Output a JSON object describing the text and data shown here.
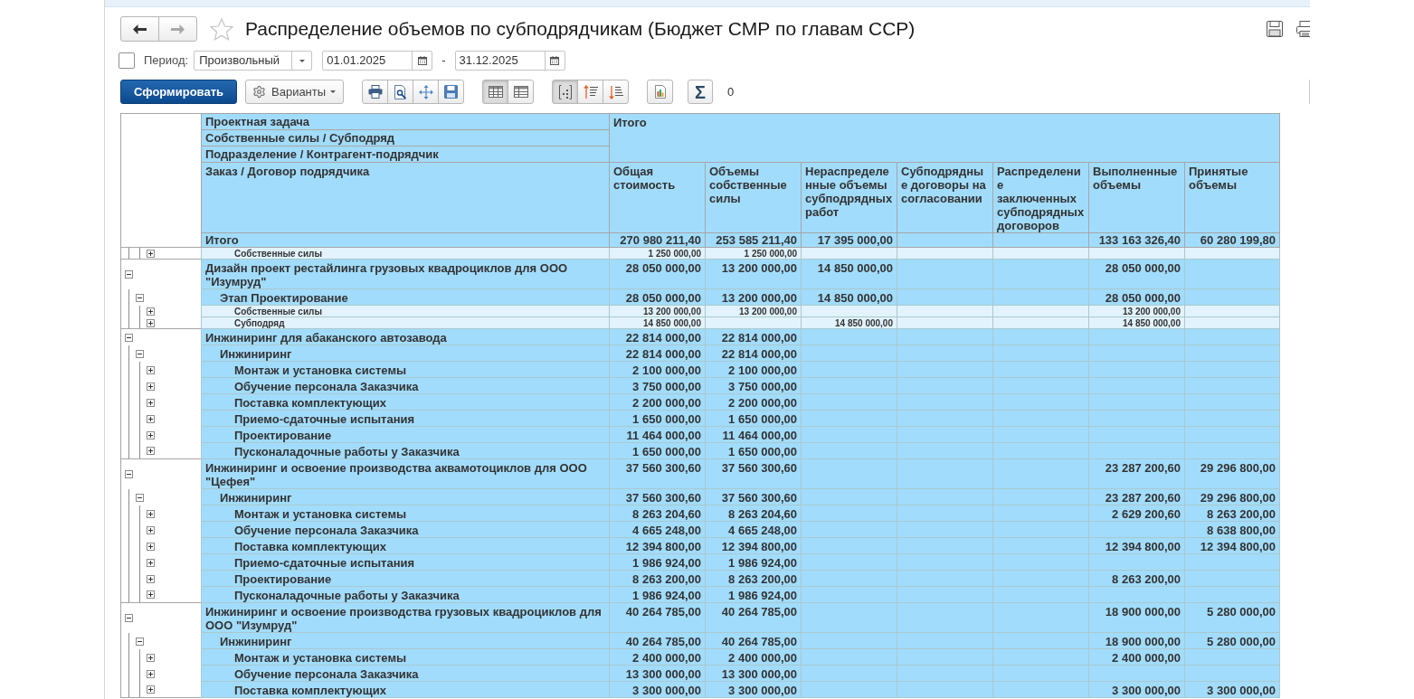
{
  "window": {
    "title": "Распределение объемов по субподрядчикам (Бюджет СМР по главам ССР)",
    "favorite": false
  },
  "nav": [
    {
      "kind": "back",
      "disabled": false
    },
    {
      "kind": "forward",
      "disabled": true
    }
  ],
  "period": {
    "checked": false,
    "label": "Период:",
    "mode": "Произвольный",
    "date_from": "01.01.2025",
    "separator": "-",
    "date_to": "31.12.2025"
  },
  "toolbar": {
    "generate": "Сформировать",
    "variants": "Варианты",
    "groups": [
      {
        "buttons": [
          {
            "kind": "print"
          },
          {
            "kind": "preview"
          },
          {
            "kind": "move"
          },
          {
            "kind": "save"
          }
        ]
      },
      {
        "buttons": [
          {
            "kind": "table",
            "selected": true
          },
          {
            "kind": "grid",
            "selected": false
          }
        ]
      },
      {
        "buttons": [
          {
            "kind": "group",
            "selected": true
          },
          {
            "kind": "sort_asc",
            "selected": false
          },
          {
            "kind": "sort_desc",
            "selected": false
          }
        ]
      },
      {
        "buttons": [
          {
            "kind": "chart"
          }
        ]
      }
    ],
    "sum": "Σ",
    "sum_value": "0"
  },
  "table": {
    "row_group_headers": [
      "Проектная задача",
      "Собственные силы / Субподряд",
      "Подразделение / Контрагент-подрядчик"
    ],
    "row_header": "Заказ / Договор подрядчика",
    "column_group": "Итого",
    "columns": [
      "Общая стоимость",
      "Объемы собственные силы",
      "Нераспределенные объемы субподрядных работ",
      "Субподрядные договоры на согласовании",
      "Распределение заключенных субподрядных договоров",
      "Выполненные объемы",
      "Принятые объемы"
    ],
    "total": {
      "label": "Итого",
      "values": {
        "total_cost": "270 980 211,40",
        "own_forces": "253 585 211,40",
        "unallocated": "17 395 000,00",
        "completed": "133 163 326,40",
        "accepted": "60 280 199,80"
      }
    },
    "rows": [
      {
        "children": [
          {
            "children": [
              {
                "kind": "detail",
                "label": "Собственные силы",
                "expanded": false,
                "values": {
                  "total_cost": "1 250 000,00",
                  "own_forces": "1 250 000,00"
                }
              }
            ]
          }
        ]
      },
      {
        "kind": "group",
        "label": "Дизайн проект рестайлинга грузовых квадроциклов для ООО \"Изумруд\"",
        "expanded": true,
        "values": {
          "total_cost": "28 050 000,00",
          "own_forces": "13 200 000,00",
          "unallocated": "14 850 000,00",
          "completed": "28 050 000,00"
        },
        "children": [
          {
            "kind": "group",
            "label": "Этап Проектирование",
            "expanded": true,
            "values": {
              "total_cost": "28 050 000,00",
              "own_forces": "13 200 000,00",
              "unallocated": "14 850 000,00",
              "completed": "28 050 000,00"
            },
            "children": [
              {
                "kind": "detail",
                "label": "Собственные силы",
                "expanded": false,
                "values": {
                  "total_cost": "13 200 000,00",
                  "own_forces": "13 200 000,00",
                  "completed": "13 200 000,00"
                }
              },
              {
                "kind": "detail",
                "label": "Субподряд",
                "expanded": false,
                "values": {
                  "total_cost": "14 850 000,00",
                  "unallocated": "14 850 000,00",
                  "completed": "14 850 000,00"
                }
              }
            ]
          }
        ]
      },
      {
        "kind": "group",
        "label": "Инжиниринг для абаканского автозавода",
        "expanded": true,
        "values": {
          "total_cost": "22 814 000,00",
          "own_forces": "22 814 000,00"
        },
        "children": [
          {
            "kind": "group",
            "label": "Инжиниринг",
            "expanded": true,
            "values": {
              "total_cost": "22 814 000,00",
              "own_forces": "22 814 000,00"
            },
            "children": [
              {
                "kind": "group",
                "label": "Монтаж и установка системы",
                "expanded": false,
                "values": {
                  "total_cost": "2 100 000,00",
                  "own_forces": "2 100 000,00"
                }
              },
              {
                "kind": "group",
                "label": "Обучение персонала Заказчика",
                "expanded": false,
                "values": {
                  "total_cost": "3 750 000,00",
                  "own_forces": "3 750 000,00"
                }
              },
              {
                "kind": "group",
                "label": "Поставка комплектующих",
                "expanded": false,
                "values": {
                  "total_cost": "2 200 000,00",
                  "own_forces": "2 200 000,00"
                }
              },
              {
                "kind": "group",
                "label": "Приемо-сдаточные испытания",
                "expanded": false,
                "values": {
                  "total_cost": "1 650 000,00",
                  "own_forces": "1 650 000,00"
                }
              },
              {
                "kind": "group",
                "label": "Проектирование",
                "expanded": false,
                "values": {
                  "total_cost": "11 464 000,00",
                  "own_forces": "11 464 000,00"
                }
              },
              {
                "kind": "group",
                "label": "Пусконаладочные работы у Заказчика",
                "expanded": false,
                "values": {
                  "total_cost": "1 650 000,00",
                  "own_forces": "1 650 000,00"
                }
              }
            ]
          }
        ]
      },
      {
        "kind": "group",
        "label": "Инжиниринг и освоение производства аквамотоциклов для ООО \"Цефея\"",
        "expanded": true,
        "values": {
          "total_cost": "37 560 300,60",
          "own_forces": "37 560 300,60",
          "completed": "23 287 200,60",
          "accepted": "29 296 800,00"
        },
        "children": [
          {
            "kind": "group",
            "label": "Инжиниринг",
            "expanded": true,
            "values": {
              "total_cost": "37 560 300,60",
              "own_forces": "37 560 300,60",
              "completed": "23 287 200,60",
              "accepted": "29 296 800,00"
            },
            "children": [
              {
                "kind": "group",
                "label": "Монтаж и установка системы",
                "expanded": false,
                "values": {
                  "total_cost": "8 263 204,60",
                  "own_forces": "8 263 204,60",
                  "completed": "2 629 200,60",
                  "accepted": "8 263 200,00"
                }
              },
              {
                "kind": "group",
                "label": "Обучение персонала Заказчика",
                "expanded": false,
                "values": {
                  "total_cost": "4 665 248,00",
                  "own_forces": "4 665 248,00",
                  "accepted": "8 638 800,00"
                }
              },
              {
                "kind": "group",
                "label": "Поставка комплектующих",
                "expanded": false,
                "values": {
                  "total_cost": "12 394 800,00",
                  "own_forces": "12 394 800,00",
                  "completed": "12 394 800,00",
                  "accepted": "12 394 800,00"
                }
              },
              {
                "kind": "group",
                "label": "Приемо-сдаточные испытания",
                "expanded": false,
                "values": {
                  "total_cost": "1 986 924,00",
                  "own_forces": "1 986 924,00"
                }
              },
              {
                "kind": "group",
                "label": "Проектирование",
                "expanded": false,
                "values": {
                  "total_cost": "8 263 200,00",
                  "own_forces": "8 263 200,00",
                  "completed": "8 263 200,00"
                }
              },
              {
                "kind": "group",
                "label": "Пусконаладочные работы у Заказчика",
                "expanded": false,
                "values": {
                  "total_cost": "1 986 924,00",
                  "own_forces": "1 986 924,00"
                }
              }
            ]
          }
        ]
      },
      {
        "kind": "group",
        "label": "Инжиниринг и освоение производства грузовых квадроциклов для ООО \"Изумруд\"",
        "expanded": true,
        "values": {
          "total_cost": "40 264 785,00",
          "own_forces": "40 264 785,00",
          "completed": "18 900 000,00",
          "accepted": "5 280 000,00"
        },
        "children": [
          {
            "kind": "group",
            "label": "Инжиниринг",
            "expanded": true,
            "values": {
              "total_cost": "40 264 785,00",
              "own_forces": "40 264 785,00",
              "completed": "18 900 000,00",
              "accepted": "5 280 000,00"
            },
            "children": [
              {
                "kind": "group",
                "label": "Монтаж и установка системы",
                "expanded": false,
                "values": {
                  "total_cost": "2 400 000,00",
                  "own_forces": "2 400 000,00",
                  "completed": "2 400 000,00"
                }
              },
              {
                "kind": "group",
                "label": "Обучение персонала Заказчика",
                "expanded": false,
                "values": {
                  "total_cost": "13 300 000,00",
                  "own_forces": "13 300 000,00"
                }
              },
              {
                "kind": "group",
                "label": "Поставка комплектующих",
                "expanded": false,
                "values": {
                  "total_cost": "3 300 000,00",
                  "own_forces": "3 300 000,00",
                  "completed": "3 300 000,00",
                  "accepted": "3 300 000,00"
                }
              }
            ]
          }
        ]
      }
    ]
  }
}
